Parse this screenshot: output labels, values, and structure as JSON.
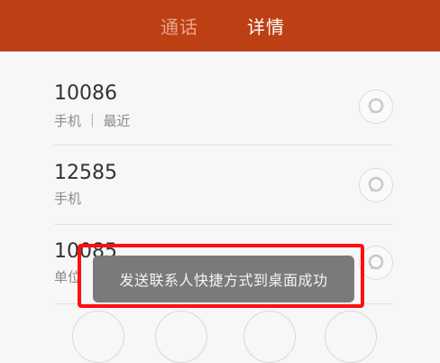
{
  "header": {
    "tabs": [
      {
        "label": "通话",
        "active": false
      },
      {
        "label": "详情",
        "active": true
      }
    ]
  },
  "contacts": [
    {
      "number": "10086",
      "meta": "手机 ｜ 最近"
    },
    {
      "number": "12585",
      "meta": "手机"
    },
    {
      "number": "10085",
      "meta": "单位"
    }
  ],
  "toast": {
    "text": "发送联系人快捷方式到桌面成功"
  },
  "colors": {
    "header": "#bd3f14",
    "toast_highlight": "#ff1010"
  },
  "icons": {
    "message": "chat-bubble-icon"
  }
}
